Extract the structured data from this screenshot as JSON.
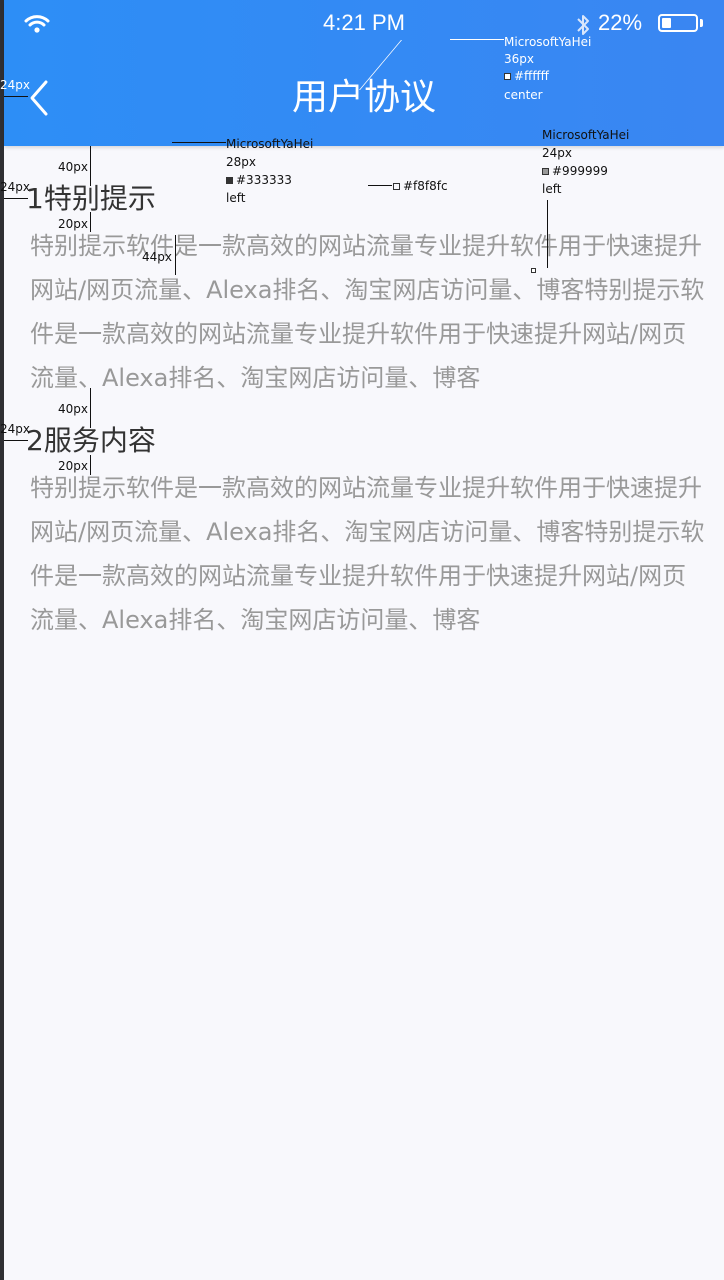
{
  "status_bar": {
    "time": "4:21 PM",
    "battery": "22%"
  },
  "nav": {
    "title": "用户协议"
  },
  "sections": [
    {
      "title": "1特别提示",
      "body": "特别提示软件是一款高效的网站流量专业提升软件用于快速提升网站/网页流量、Alexa排名、淘宝网店访问量、博客特别提示软件是一款高效的网站流量专业提升软件用于快速提升网站/网页流量、Alexa排名、淘宝网店访问量、博客"
    },
    {
      "title": "2服务内容",
      "body": "特别提示软件是一款高效的网站流量专业提升软件用于快速提升网站/网页流量、Alexa排名、淘宝网店访问量、博客特别提示软件是一款高效的网站流量专业提升软件用于快速提升网站/网页流量、Alexa排名、淘宝网店访问量、博客"
    }
  ],
  "annotations": {
    "title_spec": {
      "font": "MicrosoftYaHei",
      "size": "36px",
      "color": "#ffffff",
      "align": "center"
    },
    "heading_spec": {
      "font": "MicrosoftYaHei",
      "size": "28px",
      "color": "#333333",
      "align": "left"
    },
    "body_spec": {
      "font": "MicrosoftYaHei",
      "size": "24px",
      "color": "#999999",
      "align": "left"
    },
    "bg_color": "#f8f8fc",
    "dims": {
      "back_margin": "24px",
      "section_gap": "40px",
      "title_gap": "20px",
      "line_height": "44px",
      "left_margin": "24px",
      "section2_gap": "40px",
      "section2_title_gap": "20px",
      "section2_margin": "24px"
    }
  }
}
